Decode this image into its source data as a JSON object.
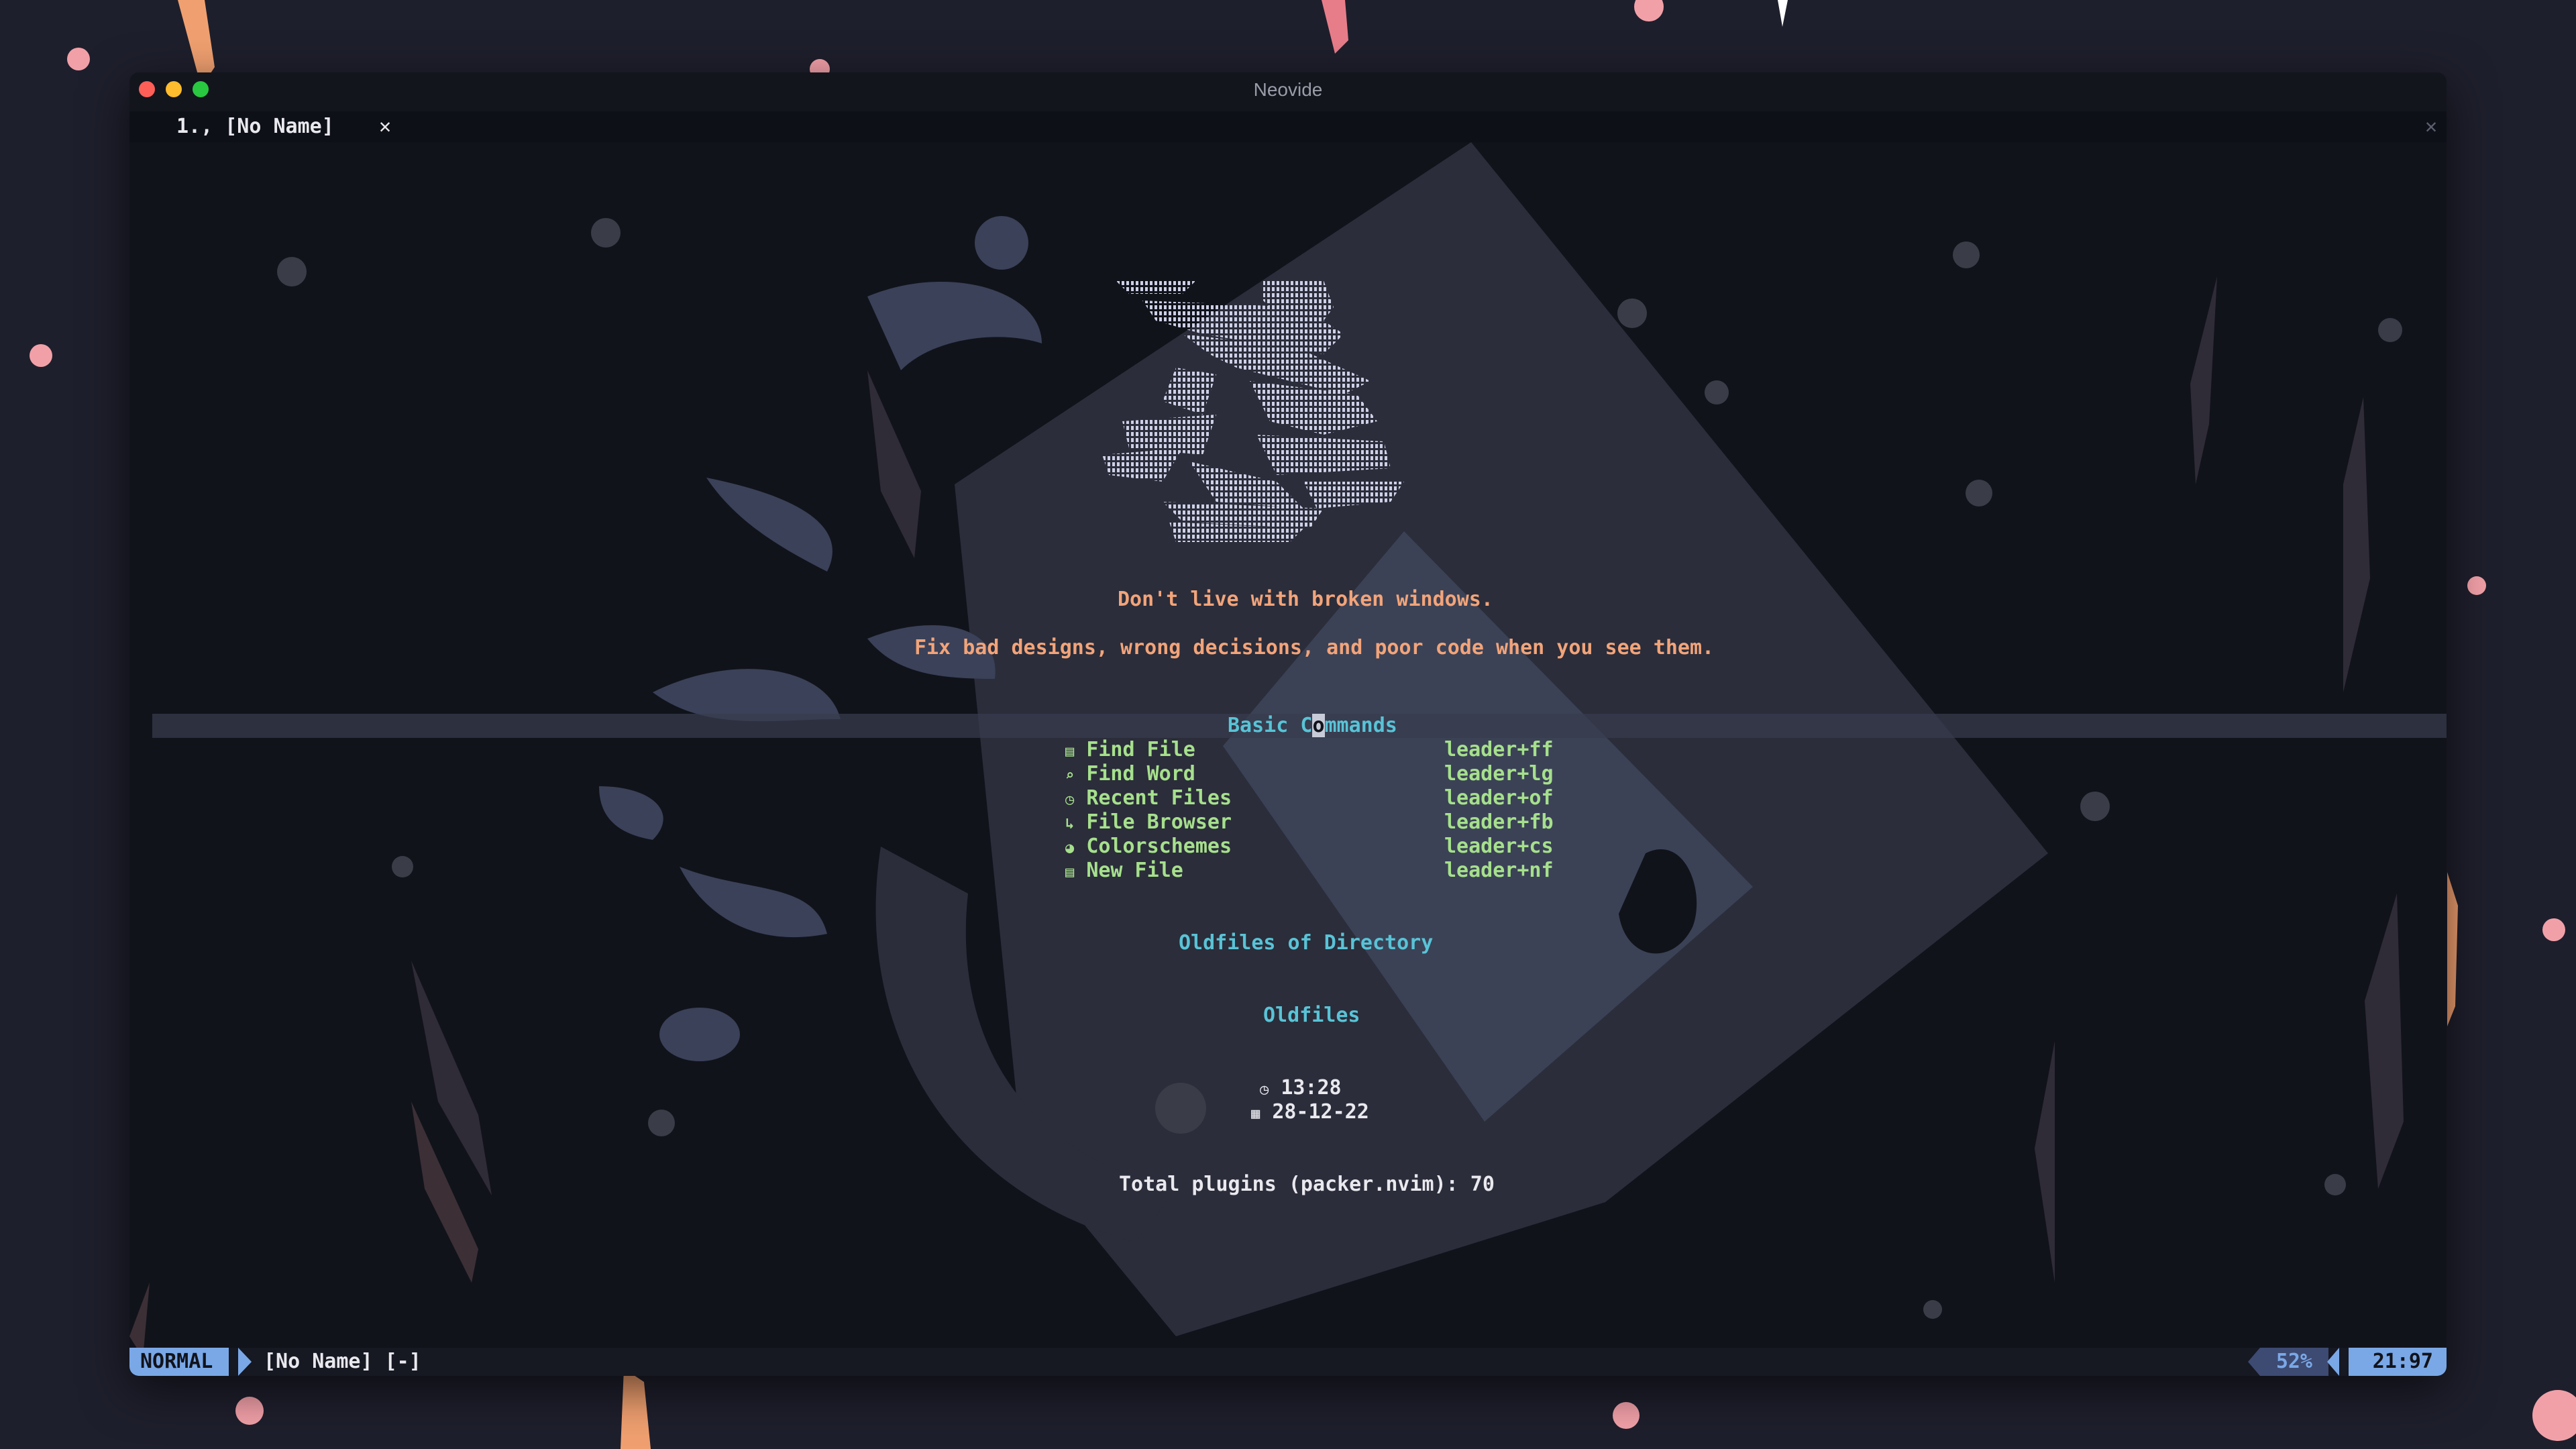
{
  "window": {
    "title": "Neovide"
  },
  "tabline": {
    "tab_label": "1., [No Name]",
    "close_glyph": "✕",
    "close_all_glyph": "✕"
  },
  "dashboard": {
    "quote_line1": "Don't live with broken windows.",
    "quote_line2": "Fix bad designs, wrong decisions, and poor code when you see them.",
    "section_basic": {
      "before": "Basic C",
      "cursor_char": "o",
      "after": "mmands"
    },
    "commands": [
      {
        "icon": "file-icon",
        "glyph": "▤",
        "label": "Find File",
        "key": "leader+ff"
      },
      {
        "icon": "search-icon",
        "glyph": "⌕",
        "label": "Find Word",
        "key": "leader+lg"
      },
      {
        "icon": "history-icon",
        "glyph": "◷",
        "label": "Recent Files",
        "key": "leader+of"
      },
      {
        "icon": "folder-tree-icon",
        "glyph": "↳",
        "label": "File Browser",
        "key": "leader+fb"
      },
      {
        "icon": "palette-icon",
        "glyph": "◕",
        "label": "Colorschemes",
        "key": "leader+cs"
      },
      {
        "icon": "new-file-icon",
        "glyph": "▤",
        "label": "New File",
        "key": "leader+nf"
      }
    ],
    "section_oldfiles_dir": "Oldfiles of Directory",
    "section_oldfiles": "Oldfiles",
    "time": "13:28",
    "date": "28-12-22",
    "footer": "Total plugins (packer.nvim): 70"
  },
  "statusline": {
    "mode": "NORMAL",
    "filename": "[No Name] [-]",
    "os_icon": "apple-icon",
    "os_glyph": "",
    "percent": "52%",
    "position": "21:97"
  },
  "colors": {
    "accent_blue": "#7aa8e6",
    "quote_orange": "#f2a47a",
    "section_cyan": "#59c3d6",
    "command_green": "#a6e08c",
    "background": "#11131b"
  }
}
